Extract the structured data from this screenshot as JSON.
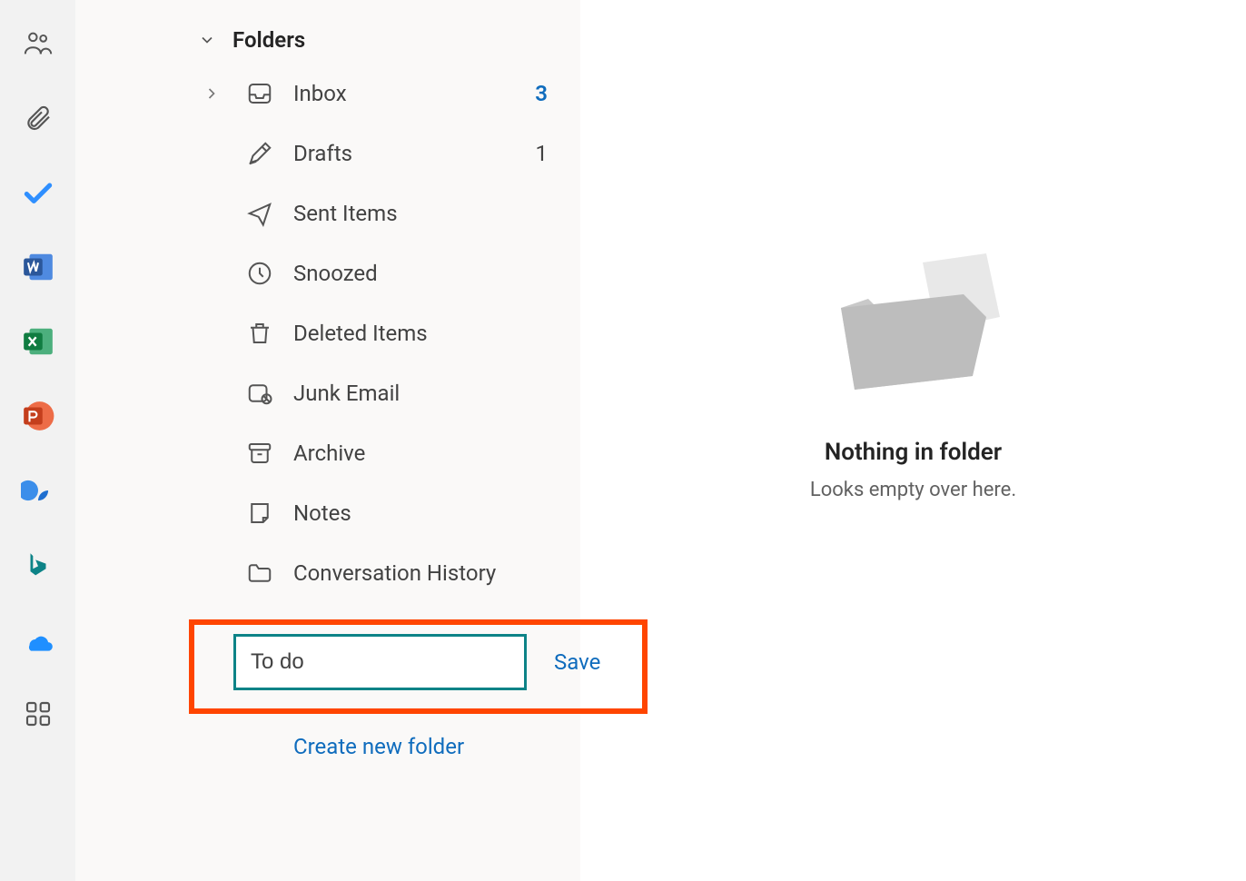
{
  "sidebar": {
    "header_label": "Folders",
    "folders": [
      {
        "icon": "inbox-icon",
        "label": "Inbox",
        "count": "3",
        "highlight": true,
        "expandable": true
      },
      {
        "icon": "drafts-icon",
        "label": "Drafts",
        "count": "1",
        "highlight": false
      },
      {
        "icon": "sent-icon",
        "label": "Sent Items"
      },
      {
        "icon": "snoozed-icon",
        "label": "Snoozed"
      },
      {
        "icon": "deleted-icon",
        "label": "Deleted Items"
      },
      {
        "icon": "junk-icon",
        "label": "Junk Email"
      },
      {
        "icon": "archive-icon",
        "label": "Archive"
      },
      {
        "icon": "notes-icon",
        "label": "Notes"
      },
      {
        "icon": "folder-icon",
        "label": "Conversation History"
      }
    ],
    "new_folder": {
      "value": "To do",
      "save_label": "Save"
    },
    "create_link_label": "Create new folder"
  },
  "rail": {
    "items": [
      "people-icon",
      "attachment-icon",
      "todo-icon",
      "word-icon",
      "excel-icon",
      "powerpoint-icon",
      "viva-icon",
      "bing-icon",
      "onedrive-icon",
      "apps-icon"
    ]
  },
  "content": {
    "empty_title": "Nothing in folder",
    "empty_subtitle": "Looks empty over here."
  }
}
